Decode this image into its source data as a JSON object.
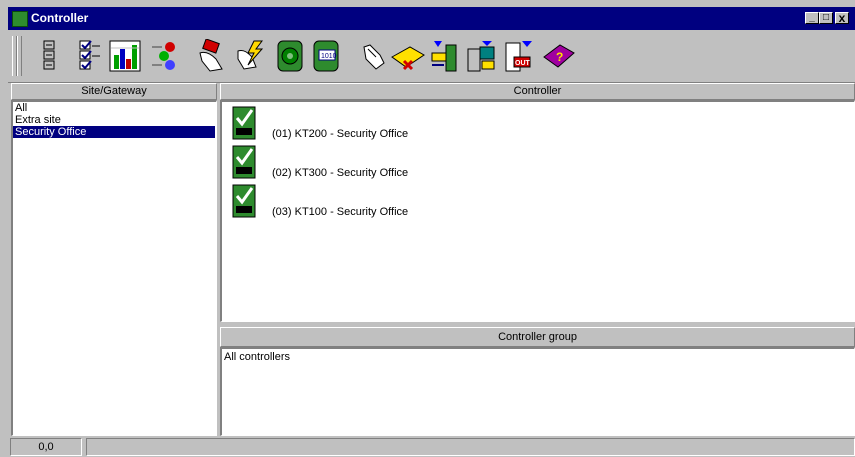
{
  "window": {
    "title": "Controller",
    "minimize": "_",
    "maximize": "□",
    "close": "x"
  },
  "toolbar": {
    "icons": [
      "list-icon",
      "checklist-icon",
      "chart-icon",
      "traffic-light-icon",
      "hand-card-icon",
      "hand-lightning-icon",
      "green-disc-icon",
      "green-card-icon",
      "pointing-hand-icon",
      "yellow-folder-icon",
      "network-transfer-icon",
      "computer-transfer-icon",
      "out-door-icon",
      "help-book-icon"
    ]
  },
  "sites": {
    "header": "Site/Gateway",
    "items": [
      {
        "label": "All"
      },
      {
        "label": "Extra site"
      },
      {
        "label": "Security Office",
        "selected": true
      }
    ]
  },
  "controllers": {
    "header": "Controller",
    "items": [
      {
        "label": "(01) KT200 - Security Office"
      },
      {
        "label": "(02) KT300 - Security Office"
      },
      {
        "label": "(03) KT100 - Security Office"
      }
    ]
  },
  "groups": {
    "header": "Controller group",
    "items": [
      "All controllers"
    ]
  },
  "status": {
    "coords": "0,0"
  },
  "colors": {
    "titlebar": "#000080",
    "selection": "#000080",
    "face": "#c0c0c0",
    "board": "#2e8b2e"
  }
}
